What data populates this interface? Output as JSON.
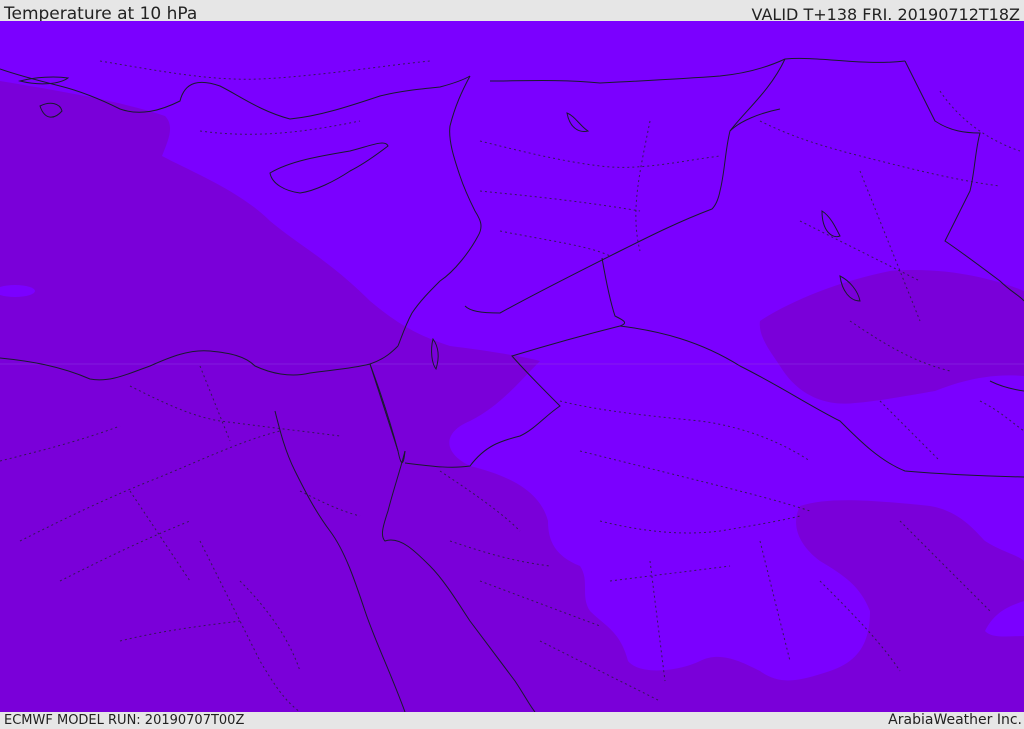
{
  "header": {
    "title": "Temperature at 10 hPa",
    "valid_time": "VALID T+138 FRI. 20190712T18Z"
  },
  "footer": {
    "model_run": "ECMWF MODEL RUN: 20190707T00Z",
    "credit": "ArabiaWeather Inc."
  },
  "map": {
    "colors": {
      "field_light": "#7b00ff",
      "field_dark": "#7a00d9",
      "coastline": "#1a1a2e",
      "borders": "#2a1a40"
    }
  }
}
